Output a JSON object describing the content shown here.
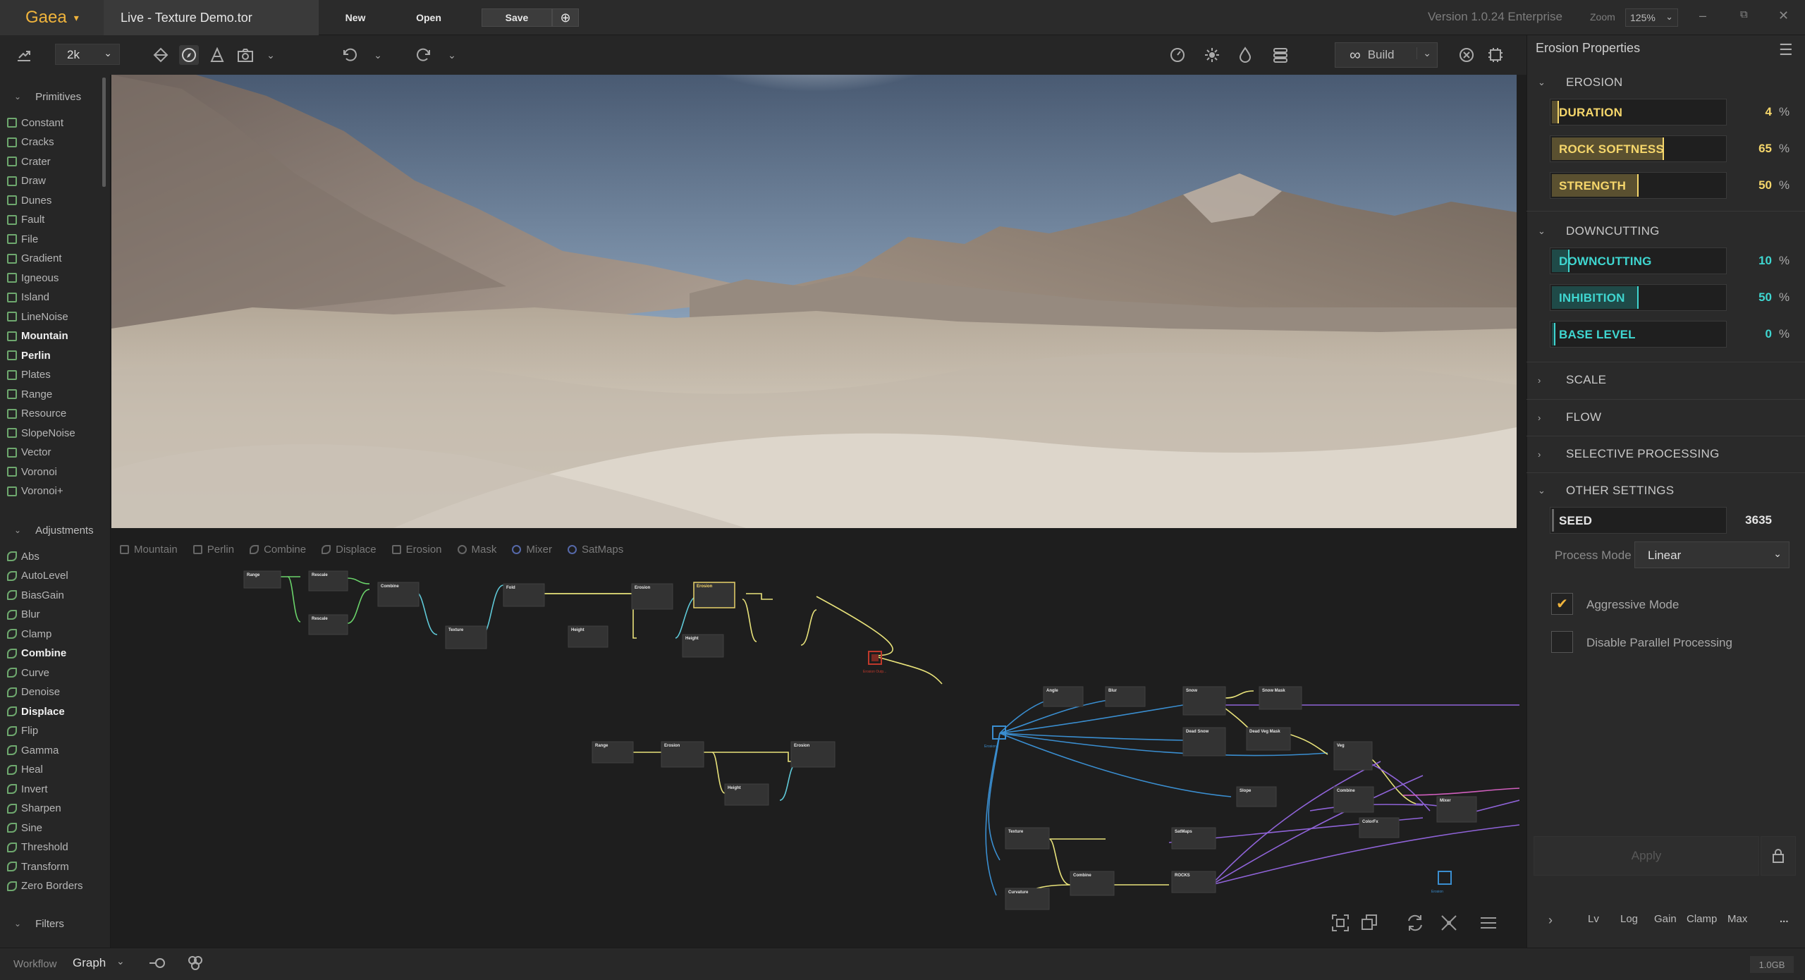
{
  "app": {
    "name": "Gaea",
    "document_tab": "Live - Texture Demo.tor",
    "version": "Version 1.0.24 Enterprise",
    "zoom_label": "Zoom",
    "zoom_value": "125%"
  },
  "titlebar": {
    "new_label": "New",
    "open_label": "Open",
    "save_label": "Save"
  },
  "toolbar": {
    "resolution": "2k",
    "build_label": "Build"
  },
  "primitives": {
    "header": "Primitives",
    "items": [
      {
        "label": "Constant",
        "bold": false
      },
      {
        "label": "Cracks",
        "bold": false
      },
      {
        "label": "Crater",
        "bold": false
      },
      {
        "label": "Draw",
        "bold": false
      },
      {
        "label": "Dunes",
        "bold": false
      },
      {
        "label": "Fault",
        "bold": false
      },
      {
        "label": "File",
        "bold": false
      },
      {
        "label": "Gradient",
        "bold": false
      },
      {
        "label": "Igneous",
        "bold": false
      },
      {
        "label": "Island",
        "bold": false
      },
      {
        "label": "LineNoise",
        "bold": false
      },
      {
        "label": "Mountain",
        "bold": true
      },
      {
        "label": "Perlin",
        "bold": true
      },
      {
        "label": "Plates",
        "bold": false
      },
      {
        "label": "Range",
        "bold": false
      },
      {
        "label": "Resource",
        "bold": false
      },
      {
        "label": "SlopeNoise",
        "bold": false
      },
      {
        "label": "Vector",
        "bold": false
      },
      {
        "label": "Voronoi",
        "bold": false
      },
      {
        "label": "Voronoi+",
        "bold": false
      }
    ]
  },
  "adjustments": {
    "header": "Adjustments",
    "items": [
      {
        "label": "Abs",
        "bold": false
      },
      {
        "label": "AutoLevel",
        "bold": false
      },
      {
        "label": "BiasGain",
        "bold": false
      },
      {
        "label": "Blur",
        "bold": false
      },
      {
        "label": "Clamp",
        "bold": false
      },
      {
        "label": "Combine",
        "bold": true
      },
      {
        "label": "Curve",
        "bold": false
      },
      {
        "label": "Denoise",
        "bold": false
      },
      {
        "label": "Displace",
        "bold": true
      },
      {
        "label": "Flip",
        "bold": false
      },
      {
        "label": "Gamma",
        "bold": false
      },
      {
        "label": "Heal",
        "bold": false
      },
      {
        "label": "Invert",
        "bold": false
      },
      {
        "label": "Sharpen",
        "bold": false
      },
      {
        "label": "Sine",
        "bold": false
      },
      {
        "label": "Threshold",
        "bold": false
      },
      {
        "label": "Transform",
        "bold": false
      },
      {
        "label": "Zero Borders",
        "bold": false
      }
    ]
  },
  "filters": {
    "header": "Filters"
  },
  "graph_tabs": [
    "Mountain",
    "Perlin",
    "Combine",
    "Displace",
    "Erosion",
    "Mask",
    "Mixer",
    "SatMaps"
  ],
  "graph_nodes": {
    "range": "Range",
    "rescale": "Rescale",
    "combine": "Combine",
    "texture": "Texture",
    "fold": "Fold",
    "height": "Height",
    "erosion": "Erosion",
    "output_label": "Erosion Outp...",
    "angle": "Angle",
    "blur": "Blur",
    "snow": "Snow",
    "snow_mask": "Snow Mask",
    "dead_snow": "Dead Snow",
    "dead_veg_mask": "Dead Veg Mask",
    "veg": "Veg",
    "slope": "Slope",
    "colorfx": "ColorFx",
    "satmaps": "SatMaps",
    "rocks": "ROCKS",
    "curvature": "Curvature",
    "mixer": "Mixer"
  },
  "properties": {
    "title": "Erosion Properties",
    "sections": {
      "erosion": "EROSION",
      "downcutting": "DOWNCUTTING",
      "scale": "SCALE",
      "flow": "FLOW",
      "selective": "SELECTIVE PROCESSING",
      "other": "OTHER SETTINGS"
    },
    "erosion_params": [
      {
        "label": "DURATION",
        "value": "4",
        "unit": "%",
        "fraction": 0.04
      },
      {
        "label": "ROCK SOFTNESS",
        "value": "65",
        "unit": "%",
        "fraction": 0.65
      },
      {
        "label": "STRENGTH",
        "value": "50",
        "unit": "%",
        "fraction": 0.5
      }
    ],
    "downcutting_params": [
      {
        "label": "DOWNCUTTING",
        "value": "10",
        "unit": "%",
        "fraction": 0.1
      },
      {
        "label": "INHIBITION",
        "value": "50",
        "unit": "%",
        "fraction": 0.5
      },
      {
        "label": "BASE LEVEL",
        "value": "0",
        "unit": "%",
        "fraction": 0.0
      }
    ],
    "seed_label": "SEED",
    "seed_value": "3635",
    "process_mode_label": "Process Mode",
    "process_mode_value": "Linear",
    "aggressive_label": "Aggressive Mode",
    "aggressive_checked": true,
    "disable_parallel_label": "Disable Parallel Processing",
    "disable_parallel_checked": false,
    "apply_label": "Apply"
  },
  "bottom_tabs": [
    "Lv",
    "Log",
    "Gain",
    "Clamp",
    "Max"
  ],
  "bottom_more": "...",
  "statusbar": {
    "workflow_label": "Workflow",
    "graph_label": "Graph",
    "memory": "1.0GB"
  },
  "colors": {
    "brand": "#f0b43c",
    "erosion_accent": "#f5d66b",
    "downcutting_accent": "#3fd6d0"
  }
}
